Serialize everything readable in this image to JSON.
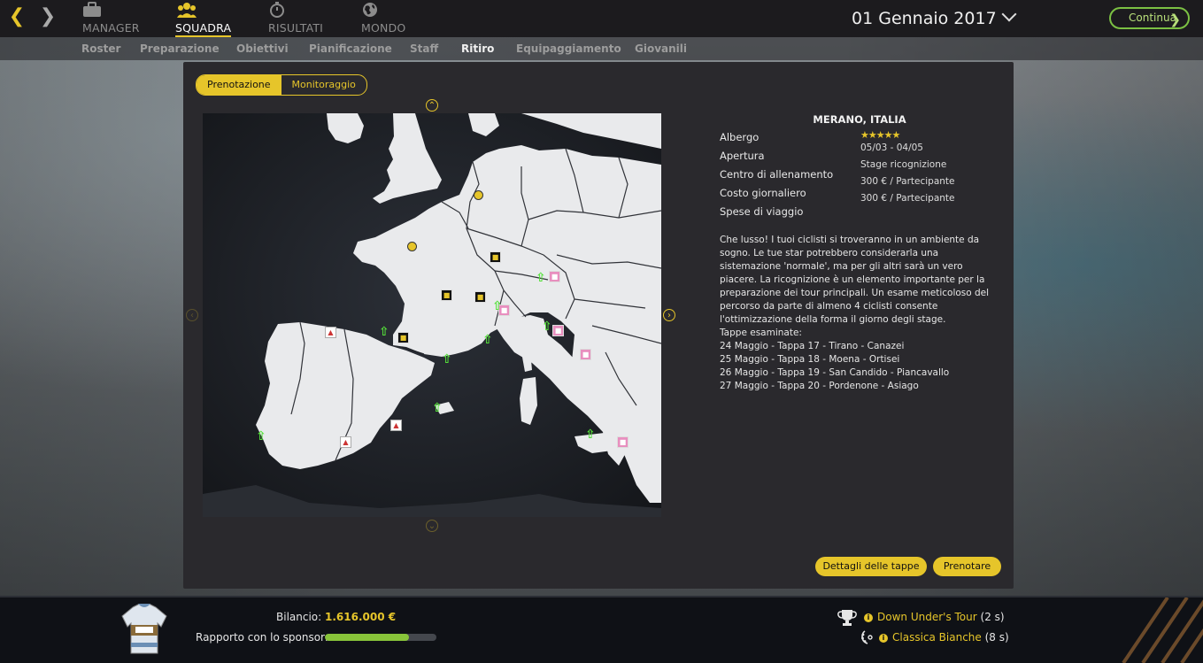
{
  "nav": {
    "items": [
      {
        "label": "MANAGER",
        "icon": "briefcase-icon"
      },
      {
        "label": "SQUADRA",
        "icon": "team-icon"
      },
      {
        "label": "RISULTATI",
        "icon": "stopwatch-icon"
      },
      {
        "label": "MONDO",
        "icon": "globe-icon"
      }
    ],
    "active": "SQUADRA"
  },
  "date": "01 Gennaio 2017",
  "continue_label": "Continua",
  "subnav": {
    "items": [
      "Roster",
      "Preparazione",
      "Obiettivi",
      "Pianificazione",
      "Staff",
      "Ritiro",
      "Equipaggiamento",
      "Giovanili"
    ],
    "active": "Ritiro"
  },
  "tabs": {
    "booking": "Prenotazione",
    "monitoring": "Monitoraggio"
  },
  "info": {
    "title": "MERANO, ITALIA",
    "labels": {
      "hotel": "Albergo",
      "opening": "Apertura",
      "training_center": "Centro di allenamento",
      "daily_cost": "Costo giornaliero",
      "travel_cost": "Spese di viaggio"
    },
    "values": {
      "stars": "★★★★★",
      "opening": "05/03 - 04/05",
      "training_center": "Stage ricognizione",
      "daily_cost": "300 € / Partecipante",
      "travel_cost": "300 € / Partecipante"
    },
    "description": "Che lusso! I tuoi ciclisti si troveranno in un ambiente da sogno. Le tue star potrebbero considerarla una sistemazione 'normale', ma per gli altri sarà un vero piacere. La ricognizione è un elemento importante per la preparazione dei tour principali. Un esame meticoloso del percorso da parte di almeno 4 ciclisti consente l'ottimizzazione della forma il giorno degli stage.",
    "stages_title": "Tappe esaminate:",
    "stages": [
      "24 Maggio - Tappa 17 - Tirano - Canazei",
      "25 Maggio - Tappa 18 - Moena - Ortisei",
      "26 Maggio - Tappa 19 - San Candido - Piancavallo",
      "27 Maggio - Tappa 20 - Pordenone - Asiago"
    ]
  },
  "buttons": {
    "stage_details": "Dettagli delle tappe",
    "book": "Prenotare"
  },
  "footer": {
    "balance_label": "Bilancio:",
    "balance_value": "1.616.000 €",
    "sponsor_label": "Rapporto con lo sponsor:",
    "sponsor_relationship": 0.75,
    "races": [
      {
        "name": "Down Under's Tour",
        "count": "(2 s)",
        "icon": "trophy-icon"
      },
      {
        "name": "Classica Bianche",
        "count": "(8 s)",
        "icon": "laurel-icon"
      }
    ]
  },
  "colors": {
    "accent": "#e6c52a",
    "continue": "#7bc043",
    "sponsor_bar": "#88c43a"
  }
}
